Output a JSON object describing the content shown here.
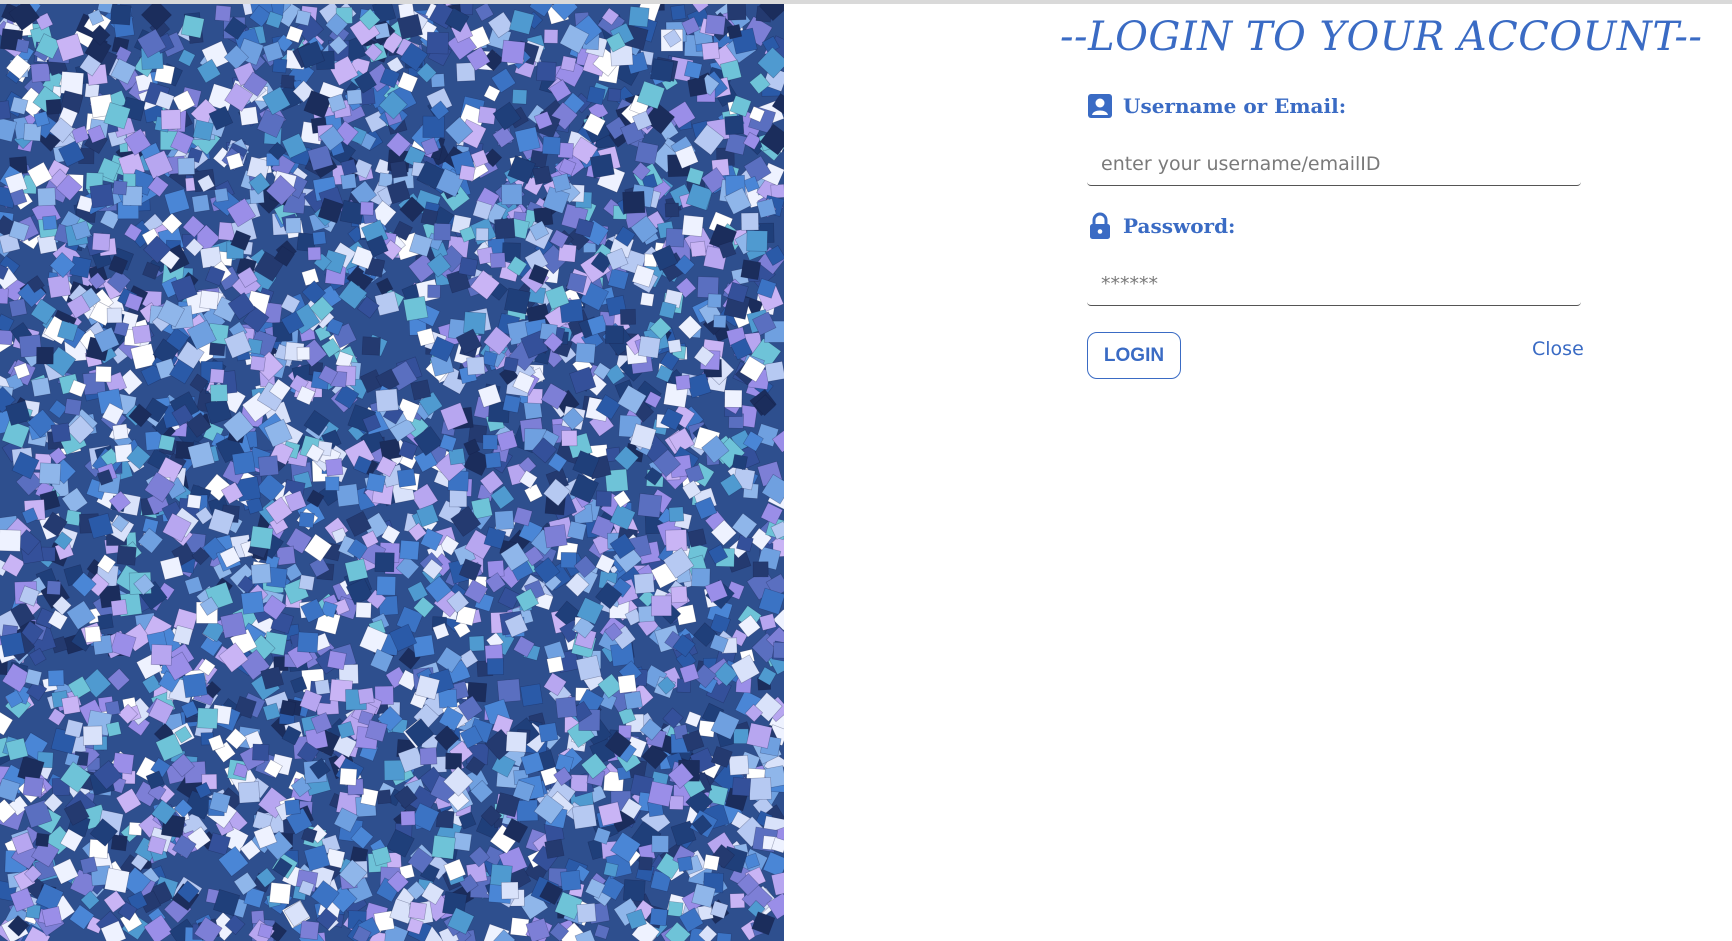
{
  "login": {
    "title": "--LOGIN TO YOUR ACCOUNT--",
    "username_label": "Username or Email:",
    "username_placeholder": "enter your username/emailID",
    "password_label": "Password:",
    "password_placeholder": "******",
    "login_button": "LOGIN",
    "close_link": "Close"
  },
  "icons": {
    "username": "account-box-icon",
    "password": "lock-icon"
  },
  "colors": {
    "accent": "#3a6bc4",
    "field_underline": "#555555",
    "background": "#ffffff"
  }
}
